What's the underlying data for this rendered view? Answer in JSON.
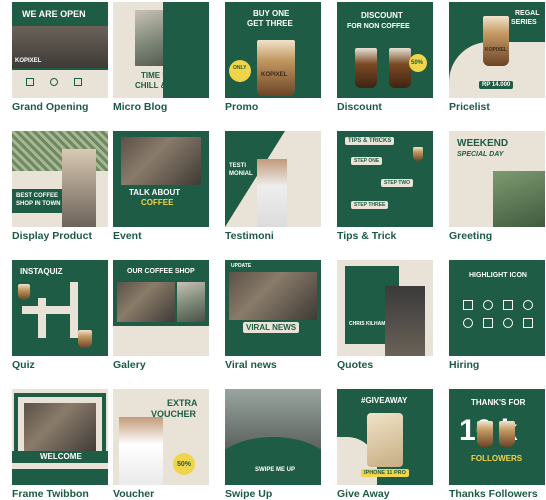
{
  "templates": [
    {
      "label": "Grand Opening",
      "text": [
        "WE ARE OPEN",
        "KOPIXEL"
      ]
    },
    {
      "label": "Micro Blog",
      "text": [
        "TIME FOR",
        "CHILL & ENJOY"
      ]
    },
    {
      "label": "Promo",
      "text": [
        "BUY ONE",
        "GET THREE",
        "ONLY",
        "KOPIXEL"
      ]
    },
    {
      "label": "Discount",
      "text": [
        "DISCOUNT",
        "FOR NON COFFEE",
        "50%"
      ]
    },
    {
      "label": "Pricelist",
      "text": [
        "REGAL",
        "SERIES",
        "KOPIXEL",
        "RP 14.000"
      ]
    },
    {
      "label": "Display Product",
      "text": [
        "BEST COFFEE",
        "SHOP IN TOWN"
      ]
    },
    {
      "label": "Event",
      "text": [
        "TALK ABOUT",
        "COFFEE"
      ]
    },
    {
      "label": "Testimoni",
      "text": [
        "TESTI",
        "MONIAL"
      ]
    },
    {
      "label": "Tips & Trick",
      "text": [
        "TIPS & TRICKS",
        "STEP ONE",
        "STEP TWO",
        "STEP THREE"
      ]
    },
    {
      "label": "Greeting",
      "text": [
        "WEEKEND",
        "SPECIAL DAY"
      ]
    },
    {
      "label": "Quiz",
      "text": [
        "INSTAQUIZ"
      ]
    },
    {
      "label": "Galery",
      "text": [
        "OUR COFFEE SHOP"
      ]
    },
    {
      "label": "Viral news",
      "text": [
        "VIRAL NEWS",
        "UPDATE"
      ]
    },
    {
      "label": "Quotes",
      "text": [
        "CHRIS KILHAM"
      ]
    },
    {
      "label": "Hiring",
      "text": [
        "HIGHLIGHT ICON"
      ]
    },
    {
      "label": "Frame Twibbon",
      "text": [
        "WELCOME"
      ]
    },
    {
      "label": "Voucher",
      "text": [
        "EXTRA",
        "VOUCHER",
        "50%"
      ]
    },
    {
      "label": "Swipe Up",
      "text": [
        "SWIPE ME UP"
      ]
    },
    {
      "label": "Give Away",
      "text": [
        "#GIVEAWAY",
        "IPHONE 11 PRO"
      ]
    },
    {
      "label": "Thanks Followers",
      "text": [
        "THANK'S FOR",
        "10 k",
        "FOLLOWERS"
      ]
    }
  ]
}
